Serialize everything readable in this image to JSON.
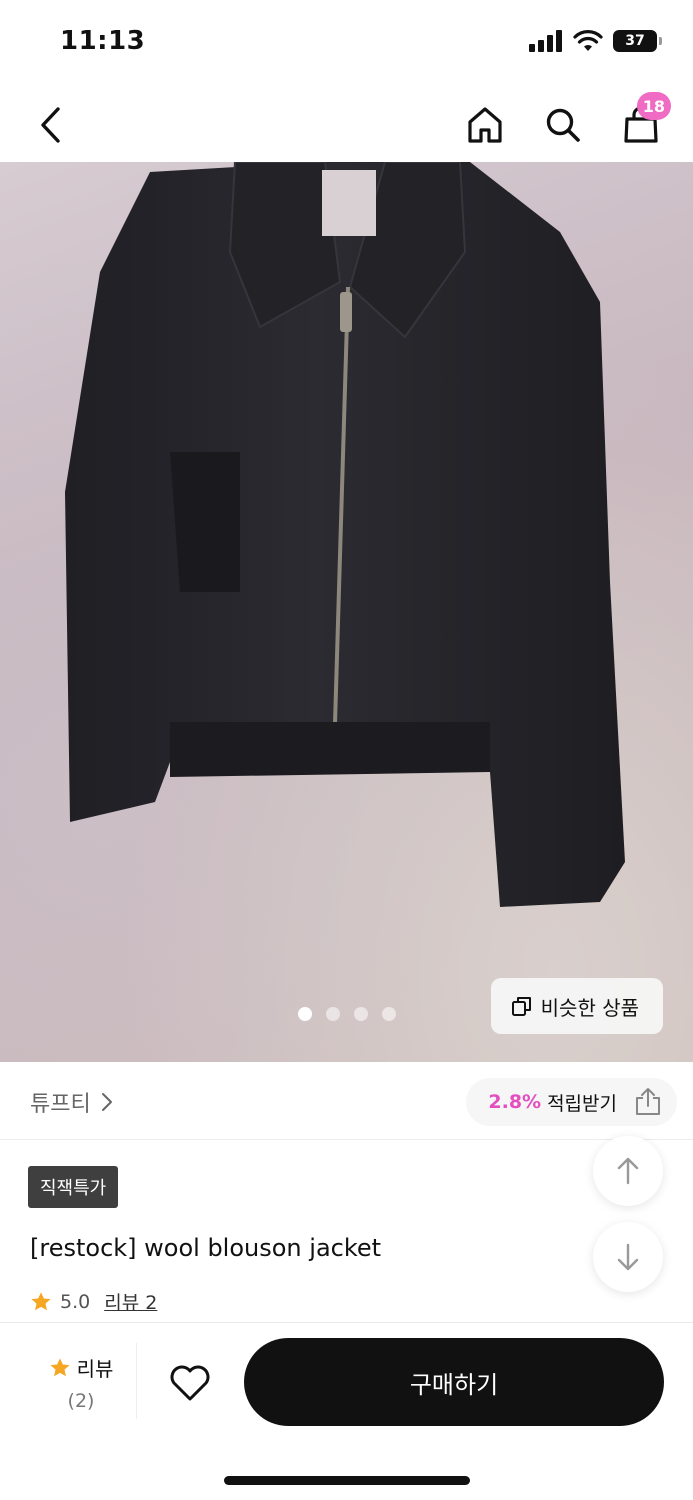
{
  "status_bar": {
    "time": "11:13",
    "battery": "37"
  },
  "nav": {
    "cart_count": "18",
    "icons": [
      "back-icon",
      "home-icon",
      "search-icon",
      "shopping-bag-icon"
    ]
  },
  "gallery": {
    "image_subject": "black wool blouson jacket",
    "total_images": 4,
    "active_index": 0,
    "similar_button_label": "비슷한 상품"
  },
  "brand": {
    "name": "튜프티",
    "points_rate": "2.8%",
    "points_label": "적립받기"
  },
  "product": {
    "promo_badge": "직잭특가",
    "name": "[restock] wool blouson jacket",
    "rating": "5.0",
    "review_link": "리뷰 2"
  },
  "bottom_bar": {
    "review_label": "리뷰",
    "review_count": "(2)",
    "buy_label": "구매하기"
  },
  "colors": {
    "accent_pink": "#e44fc0",
    "star": "#f5a623",
    "buy_button": "#111111"
  }
}
